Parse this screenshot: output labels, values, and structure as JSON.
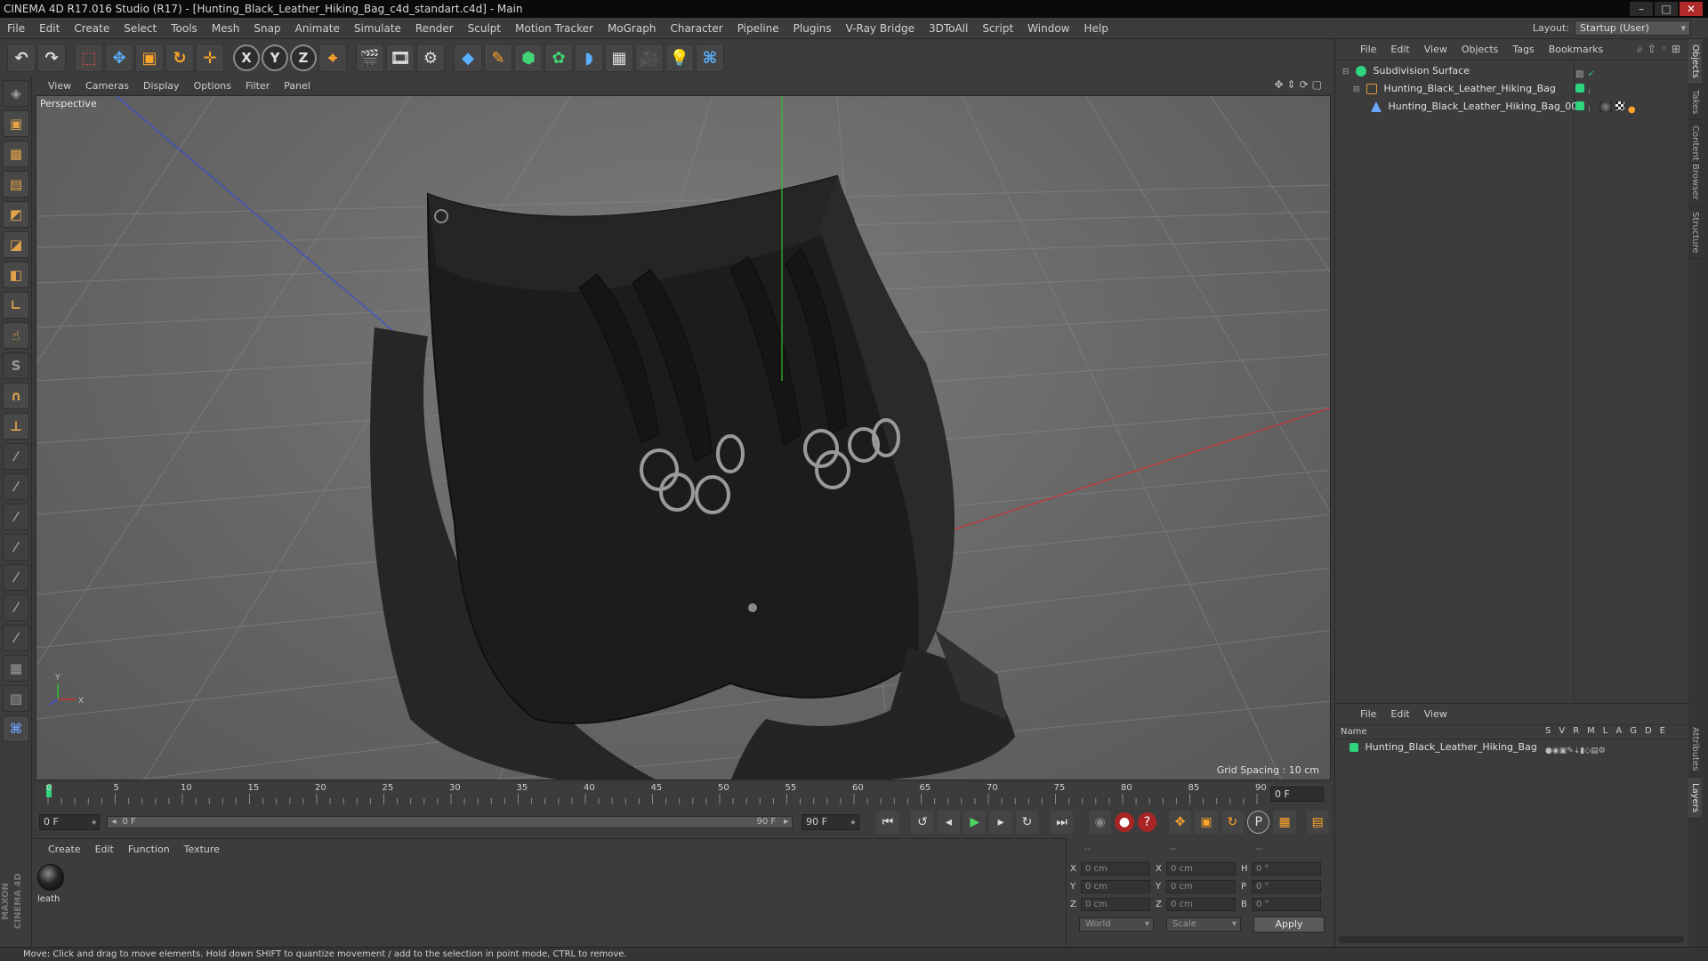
{
  "window": {
    "title": "CINEMA 4D R17.016 Studio (R17) - [Hunting_Black_Leather_Hiking_Bag_c4d_standart.c4d] - Main"
  },
  "menu": [
    "File",
    "Edit",
    "Create",
    "Select",
    "Tools",
    "Mesh",
    "Snap",
    "Animate",
    "Simulate",
    "Render",
    "Sculpt",
    "Motion Tracker",
    "MoGraph",
    "Character",
    "Pipeline",
    "Plugins",
    "V-Ray Bridge",
    "3DToAll",
    "Script",
    "Window",
    "Help"
  ],
  "layout": {
    "label": "Layout:",
    "value": "Startup (User)"
  },
  "toolbar": {
    "x_axis": "X",
    "y_axis": "Y",
    "z_axis": "Z"
  },
  "viewport": {
    "menu": [
      "View",
      "Cameras",
      "Display",
      "Options",
      "Filter",
      "Panel"
    ],
    "label": "Perspective",
    "grid_spacing": "Grid Spacing : 10 cm",
    "axis_y": "Y",
    "axis_x": "X"
  },
  "timeline": {
    "ticks": [
      "0",
      "5",
      "10",
      "15",
      "20",
      "25",
      "30",
      "35",
      "40",
      "45",
      "50",
      "55",
      "60",
      "65",
      "70",
      "75",
      "80",
      "85",
      "90"
    ],
    "current_frame": "0 F"
  },
  "transport": {
    "start_field": "0 F",
    "range_start": "0 F",
    "range_end": "90 F",
    "end_field": "90 F"
  },
  "material_panel": {
    "menu": [
      "Create",
      "Edit",
      "Function",
      "Texture"
    ],
    "material_name": "leath"
  },
  "coords": {
    "headers": [
      "--",
      "--",
      "--"
    ],
    "rows": [
      {
        "l1": "X",
        "v1": "0 cm",
        "l2": "X",
        "v2": "0 cm",
        "l3": "H",
        "v3": "0 °"
      },
      {
        "l1": "Y",
        "v1": "0 cm",
        "l2": "Y",
        "v2": "0 cm",
        "l3": "P",
        "v3": "0 °"
      },
      {
        "l1": "Z",
        "v1": "0 cm",
        "l2": "Z",
        "v2": "0 cm",
        "l3": "B",
        "v3": "0 °"
      }
    ],
    "mode": "World",
    "scale": "Scale",
    "apply": "Apply"
  },
  "object_manager": {
    "menu": [
      "File",
      "Edit",
      "View",
      "Objects",
      "Tags",
      "Bookmarks"
    ],
    "objects": [
      {
        "name": "Subdivision Surface",
        "depth": 0
      },
      {
        "name": "Hunting_Black_Leather_Hiking_Bag",
        "depth": 1
      },
      {
        "name": "Hunting_Black_Leather_Hiking_Bag_001",
        "depth": 2
      }
    ]
  },
  "layer_manager": {
    "menu": [
      "File",
      "Edit",
      "View"
    ],
    "name_header": "Name",
    "columns": [
      "S",
      "V",
      "R",
      "M",
      "L",
      "A",
      "G",
      "D",
      "E"
    ],
    "layers": [
      {
        "name": "Hunting_Black_Leather_Hiking_Bag"
      }
    ]
  },
  "side_tabs": [
    "Objects",
    "Takes",
    "Content Browser",
    "Structure",
    "Attributes",
    "Layers"
  ],
  "status": "Move: Click and drag to move elements. Hold down SHIFT to quantize movement / add to the selection in point mode, CTRL to remove.",
  "brand": "MAXON CINEMA 4D",
  "colors": {
    "green_tag": "#2fd47e",
    "axis_x": "#d03030",
    "axis_y": "#30c030",
    "axis_z": "#3a4fd0",
    "accent_orange": "#ffa42a"
  }
}
